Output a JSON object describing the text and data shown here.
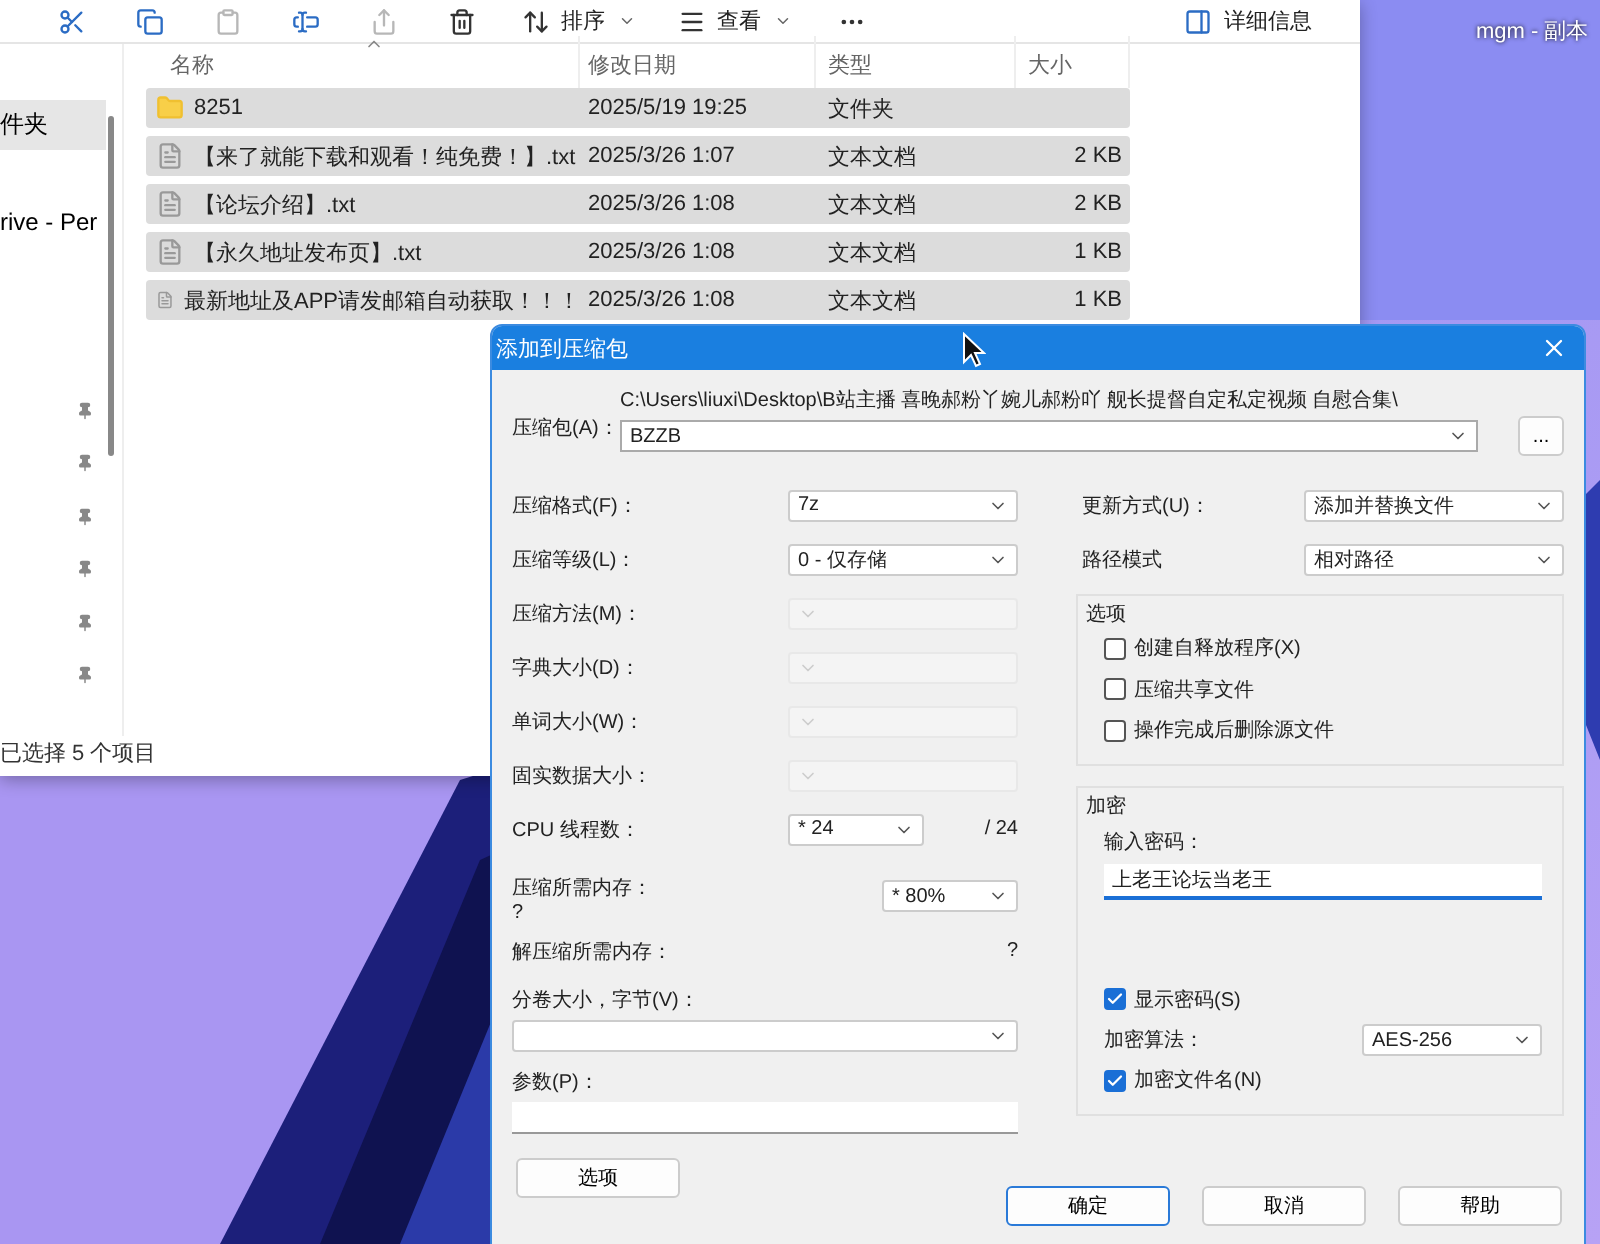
{
  "desktop": {
    "icon_label": "mgm - 副本"
  },
  "explorer": {
    "toolbar": [
      {
        "kind": "cut",
        "disabled": false
      },
      {
        "kind": "copy",
        "disabled": false
      },
      {
        "kind": "paste",
        "disabled": true
      },
      {
        "kind": "rename",
        "disabled": false
      },
      {
        "kind": "share",
        "disabled": true
      },
      {
        "kind": "delete",
        "disabled": false
      },
      {
        "kind": "sort",
        "label": "排序"
      },
      {
        "kind": "view",
        "label": "查看"
      },
      {
        "kind": "more"
      }
    ],
    "details": "详细信息",
    "sidebar": {
      "items": [
        {
          "label": "件夹",
          "selected": true
        },
        {
          "label": "rive - Per",
          "selected": false
        }
      ]
    },
    "columns": [
      {
        "label": "名称",
        "sorted": true
      },
      {
        "label": "修改日期",
        "sorted": false
      },
      {
        "label": "类型",
        "sorted": false
      },
      {
        "label": "大小",
        "sorted": false
      }
    ],
    "rows": [
      {
        "kind": "folder",
        "name": "8251",
        "modified": "2025/5/19 19:25",
        "type": "文件夹",
        "selected": true
      },
      {
        "kind": "text",
        "name": "【来了就能下载和观看！纯免费！】.txt",
        "modified": "2025/3/26 1:07",
        "type": "文本文档",
        "size": "2 KB",
        "selected": true
      },
      {
        "kind": "text",
        "name": "【论坛介绍】.txt",
        "modified": "2025/3/26 1:08",
        "type": "文本文档",
        "size": "2 KB",
        "selected": true
      },
      {
        "kind": "text",
        "name": "【永久地址发布页】.txt",
        "modified": "2025/3/26 1:08",
        "type": "文本文档",
        "size": "1 KB",
        "selected": true
      },
      {
        "kind": "text",
        "name": "最新地址及APP请发邮箱自动获取！！！",
        "modified": "2025/3/26 1:08",
        "type": "文本文档",
        "size": "1 KB",
        "selected": true
      }
    ],
    "status_bar": "已选择 5 个项目"
  },
  "dialog": {
    "title": "添加到压缩包",
    "archive": {
      "label": "压缩包(A)：",
      "path": "C:\\Users\\liuxi\\Desktop\\B站主播 喜晚郝粉丫婉儿郝粉吖 舰长提督自定私定视频 自慰合集\\",
      "value": "BZZB",
      "browse": "..."
    },
    "left_fields": [
      {
        "kind": "select",
        "label": "压缩格式(F)：",
        "value": "7z",
        "disabled": false
      },
      {
        "kind": "select",
        "label": "压缩等级(L)：",
        "value": "0 - 仅存储",
        "disabled": false
      },
      {
        "kind": "select",
        "label": "压缩方法(M)：",
        "disabled": true
      },
      {
        "kind": "select",
        "label": "字典大小(D)：",
        "disabled": true
      },
      {
        "kind": "select",
        "label": "单词大小(W)：",
        "disabled": true
      },
      {
        "kind": "select",
        "label": "固实数据大小：",
        "disabled": true
      },
      {
        "kind": "threads",
        "label": "CPU 线程数：",
        "value": "* 24",
        "note": "/ 24"
      },
      {
        "kind": "memory",
        "label": "压缩所需内存：",
        "note": "?",
        "value": "* 80%"
      },
      {
        "kind": "info",
        "label": "解压缩所需内存：",
        "note": "?"
      },
      {
        "kind": "wide_select",
        "label": "分卷大小，字节(V)："
      },
      {
        "kind": "wide_input",
        "label": "参数(P)："
      }
    ],
    "options_button": "选项",
    "right_fields": [
      {
        "label": "更新方式(U)：",
        "value": "添加并替换文件"
      },
      {
        "label": "路径模式",
        "value": "相对路径"
      }
    ],
    "options_group": {
      "title": "选项",
      "checkboxes": [
        {
          "label": "创建自释放程序(X)",
          "checked": false
        },
        {
          "label": "压缩共享文件",
          "checked": false
        },
        {
          "label": "操作完成后删除源文件",
          "checked": false
        }
      ]
    },
    "encryption": {
      "title": "加密",
      "password_label": "输入密码：",
      "password": "上老王论坛当老王",
      "show_password": {
        "label": "显示密码(S)",
        "checked": true
      },
      "method_label": "加密算法：",
      "method": "AES-256",
      "encrypt_names": {
        "label": "加密文件名(N)",
        "checked": true
      }
    },
    "buttons": [
      {
        "label": "确定",
        "default": true
      },
      {
        "label": "取消",
        "default": false
      },
      {
        "label": "帮助",
        "default": false
      }
    ]
  }
}
